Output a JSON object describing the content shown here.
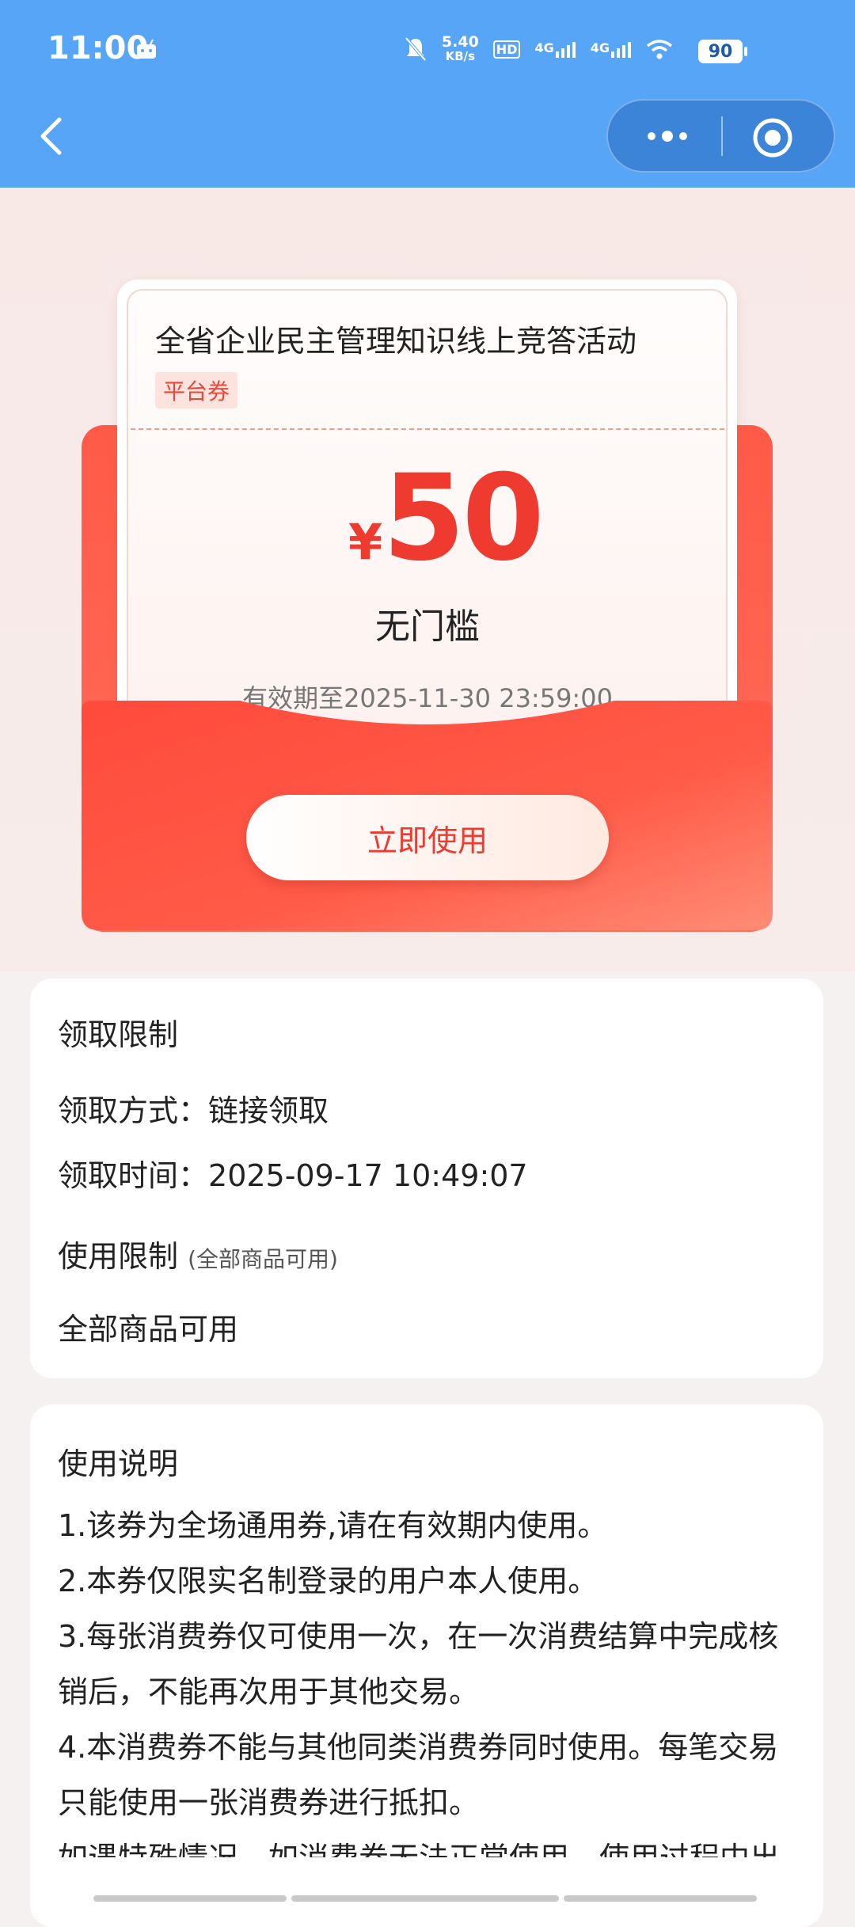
{
  "status_bar": {
    "time": "11:00",
    "net_speed_value": "5.40",
    "net_speed_unit": "KB/s",
    "hd_label": "HD",
    "signal1": "4G",
    "signal2": "4G",
    "battery": "90"
  },
  "nav": {
    "back_icon": "chevron-left-icon",
    "more_icon": "more-dots-icon",
    "close_icon": "target-close-icon"
  },
  "coupon": {
    "title": "全省企业民主管理知识线上竞答活动",
    "tag": "平台券",
    "currency": "¥",
    "amount": "50",
    "threshold": "无门槛",
    "validity": "有效期至2025-11-30 23:59:00",
    "use_button": "立即使用"
  },
  "claim_limits": {
    "heading": "领取限制",
    "method_label": "领取方式：",
    "method_value": "链接领取",
    "time_label": "领取时间：",
    "time_value": "2025-09-17 10:49:07",
    "usage_heading": "使用限制",
    "usage_note": "(全部商品可用)",
    "usage_value": "全部商品可用"
  },
  "instructions": {
    "heading": "使用说明",
    "lines": [
      "1.该券为全场通用券,请在有效期内使用。",
      "2.本券仅限实名制登录的用户本人使用。",
      "3.每张消费券仅可使用一次，在一次消费结算中完成核",
      "销后，不能再次用于其他交易。",
      "4.本消费券不能与其他同类消费券同时使用。每笔交易",
      "只能使用一张消费券进行抵扣。",
      "如遇特殊情况，如消费券无法正常使用，使用过程中出"
    ]
  },
  "colors": {
    "topbar": "#56a5f7",
    "accent_red": "#ef3a2f",
    "envelope": "#ff5a48"
  }
}
